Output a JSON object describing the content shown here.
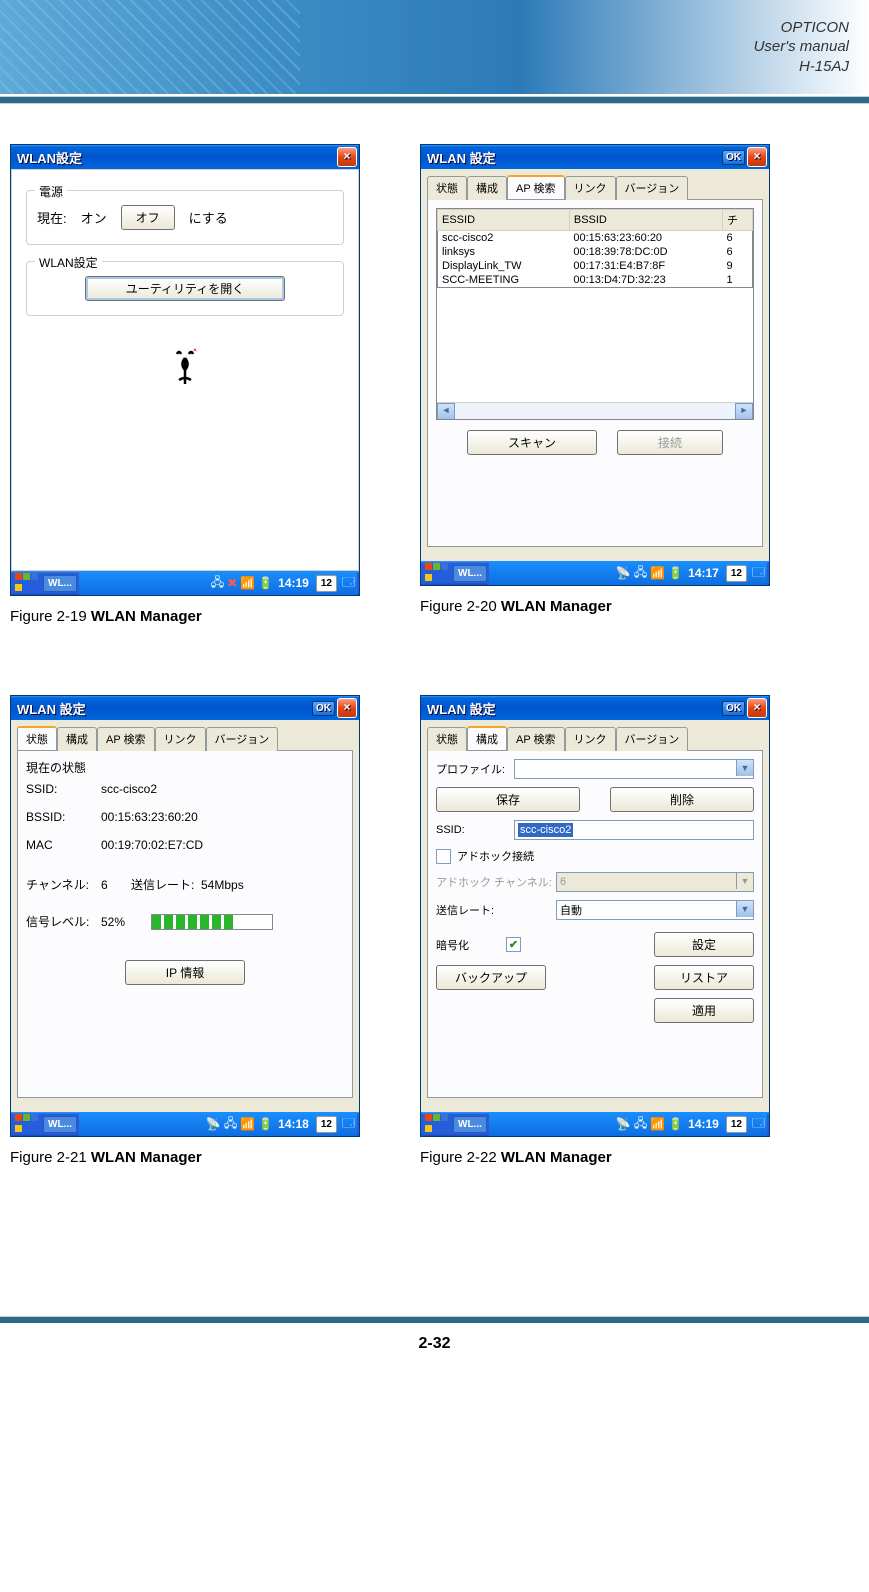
{
  "header": {
    "line1": "OPTICON",
    "line2": "User's manual",
    "line3": "H-15AJ"
  },
  "page_number": "2-32",
  "figures": {
    "f19": {
      "caption_prefix": "Figure 2-19 ",
      "caption_bold": "WLAN Manager"
    },
    "f20": {
      "caption_prefix": "Figure 2-20 ",
      "caption_bold": "WLAN Manager"
    },
    "f21": {
      "caption_prefix": "Figure 2-21 ",
      "caption_bold": "WLAN Manager"
    },
    "f22": {
      "caption_prefix": "Figure 2-22 ",
      "caption_bold": "WLAN Manager"
    }
  },
  "win19": {
    "title": "WLAN設定",
    "power_group": "電源",
    "current_label": "現在:",
    "current_value": "オン",
    "toggle_button": "オフ",
    "toggle_suffix": "にする",
    "settings_group": "WLAN設定",
    "utility_button": "ユーティリティを開く",
    "task_item": "WL...",
    "clock": "14:19",
    "date": "12"
  },
  "win20": {
    "title": "WLAN 設定",
    "tabs": [
      "状態",
      "構成",
      "AP 検索",
      "リンク",
      "バージョン"
    ],
    "active_tab": 2,
    "columns": [
      "ESSID",
      "BSSID",
      "チ"
    ],
    "rows": [
      {
        "essid": "scc-cisco2",
        "bssid": "00:15:63:23:60:20",
        "ch": "6"
      },
      {
        "essid": "linksys",
        "bssid": "00:18:39:78:DC:0D",
        "ch": "6"
      },
      {
        "essid": "DisplayLink_TW",
        "bssid": "00:17:31:E4:B7:8F",
        "ch": "9"
      },
      {
        "essid": "SCC-MEETING",
        "bssid": "00:13:D4:7D:32:23",
        "ch": "1"
      }
    ],
    "scan_button": "スキャン",
    "connect_button": "接続",
    "task_item": "WL...",
    "clock": "14:17",
    "date": "12"
  },
  "win21": {
    "title": "WLAN 設定",
    "tabs": [
      "状態",
      "構成",
      "AP 検索",
      "リンク",
      "バージョン"
    ],
    "active_tab": 0,
    "status_header": "現在の状態",
    "ssid_label": "SSID:",
    "ssid_value": "scc-cisco2",
    "bssid_label": "BSSID:",
    "bssid_value": "00:15:63:23:60:20",
    "mac_label": "MAC",
    "mac_value": "00:19:70:02:E7:CD",
    "channel_label": "チャンネル:",
    "channel_value": "6",
    "txrate_label": "送信レート:",
    "txrate_value": "54Mbps",
    "signal_label": "信号レベル:",
    "signal_value": "52%",
    "signal_percent": 52,
    "ip_button": "IP 情報",
    "task_item": "WL...",
    "clock": "14:18",
    "date": "12"
  },
  "win22": {
    "title": "WLAN 設定",
    "tabs": [
      "状態",
      "構成",
      "AP 検索",
      "リンク",
      "バージョン"
    ],
    "active_tab": 1,
    "profile_label": "プロファイル:",
    "profile_value": "",
    "save_button": "保存",
    "delete_button": "削除",
    "ssid_label": "SSID:",
    "ssid_value": "scc-cisco2",
    "adhoc_label": "アドホック接続",
    "adhoc_channel_label": "アドホック チャンネル:",
    "adhoc_channel_value": "6",
    "txrate_label": "送信レート:",
    "txrate_value": "自動",
    "encrypt_label": "暗号化",
    "encrypt_checked": true,
    "settings_button": "設定",
    "backup_button": "バックアップ",
    "restore_button": "リストア",
    "apply_button": "適用",
    "task_item": "WL...",
    "clock": "14:19",
    "date": "12"
  }
}
